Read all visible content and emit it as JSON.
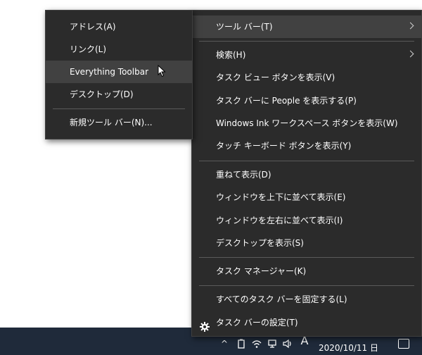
{
  "context_menu": {
    "items": [
      {
        "label": "ツール バー(T)"
      },
      {
        "label": "検索(H)"
      },
      {
        "label": "タスク ビュー ボタンを表示(V)"
      },
      {
        "label": "タスク バーに People を表示する(P)"
      },
      {
        "label": "Windows Ink ワークスペース ボタンを表示(W)"
      },
      {
        "label": "タッチ キーボード ボタンを表示(Y)"
      },
      {
        "label": "重ねて表示(D)"
      },
      {
        "label": "ウィンドウを上下に並べて表示(E)"
      },
      {
        "label": "ウィンドウを左右に並べて表示(I)"
      },
      {
        "label": "デスクトップを表示(S)"
      },
      {
        "label": "タスク マネージャー(K)"
      },
      {
        "label": "すべてのタスク バーを固定する(L)"
      },
      {
        "label": "タスク バーの設定(T)",
        "icon": "gear-icon"
      }
    ]
  },
  "toolbars_submenu": {
    "items": [
      {
        "label": "アドレス(A)"
      },
      {
        "label": "リンク(L)"
      },
      {
        "label": "Everything Toolbar"
      },
      {
        "label": "デスクトップ(D)"
      },
      {
        "label": "新規ツール バー(N)..."
      }
    ]
  },
  "taskbar": {
    "clock": "2020/10/11 日",
    "ime_indicator": "A"
  },
  "colors": {
    "menu_bg": "#2b2b2b",
    "highlight": "#414141",
    "taskbar": "#1f2a3a",
    "text": "#ffffff"
  }
}
